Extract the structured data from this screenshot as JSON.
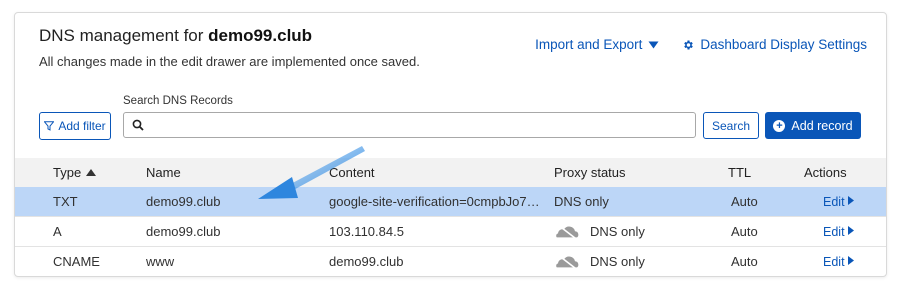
{
  "header": {
    "title_prefix": "DNS management for ",
    "domain": "demo99.club",
    "subtitle": "All changes made in the edit drawer are implemented once saved.",
    "import_export": "Import and Export",
    "dashboard_settings": "Dashboard Display Settings"
  },
  "toolbar": {
    "add_filter": "Add filter",
    "search_label": "Search DNS Records",
    "search_value": "",
    "search_button": "Search",
    "add_record": "Add record"
  },
  "table": {
    "columns": {
      "type": "Type",
      "name": "Name",
      "content": "Content",
      "proxy": "Proxy status",
      "ttl": "TTL",
      "actions": "Actions"
    },
    "rows": [
      {
        "type": "TXT",
        "name": "demo99.club",
        "content": "google-site-verification=0cmpbJo7Up…",
        "proxy": "DNS only",
        "ttl": "Auto",
        "action": "Edit",
        "selected": true,
        "proxy_icon": "none"
      },
      {
        "type": "A",
        "name": "demo99.club",
        "content": "103.110.84.5",
        "proxy": "DNS only",
        "ttl": "Auto",
        "action": "Edit",
        "selected": false,
        "proxy_icon": "cloud-icon"
      },
      {
        "type": "CNAME",
        "name": "www",
        "content": "demo99.club",
        "proxy": "DNS only",
        "ttl": "Auto",
        "action": "Edit",
        "selected": false,
        "proxy_icon": "cloud-icon"
      }
    ]
  },
  "icons": {
    "filter": "funnel-icon",
    "search": "magnifier-icon",
    "add": "plus-circle-icon",
    "settings": "gear-icon",
    "dropdown": "caret-down-icon",
    "sort": "sort-up-icon",
    "edit": "caret-right-icon",
    "annotation": "arrow-annotation"
  },
  "colors": {
    "accent": "#0a56b8",
    "selected_row": "#bcd6f7",
    "header_bg": "#f2f2f2",
    "annotation_arrow": "#2e86de"
  }
}
